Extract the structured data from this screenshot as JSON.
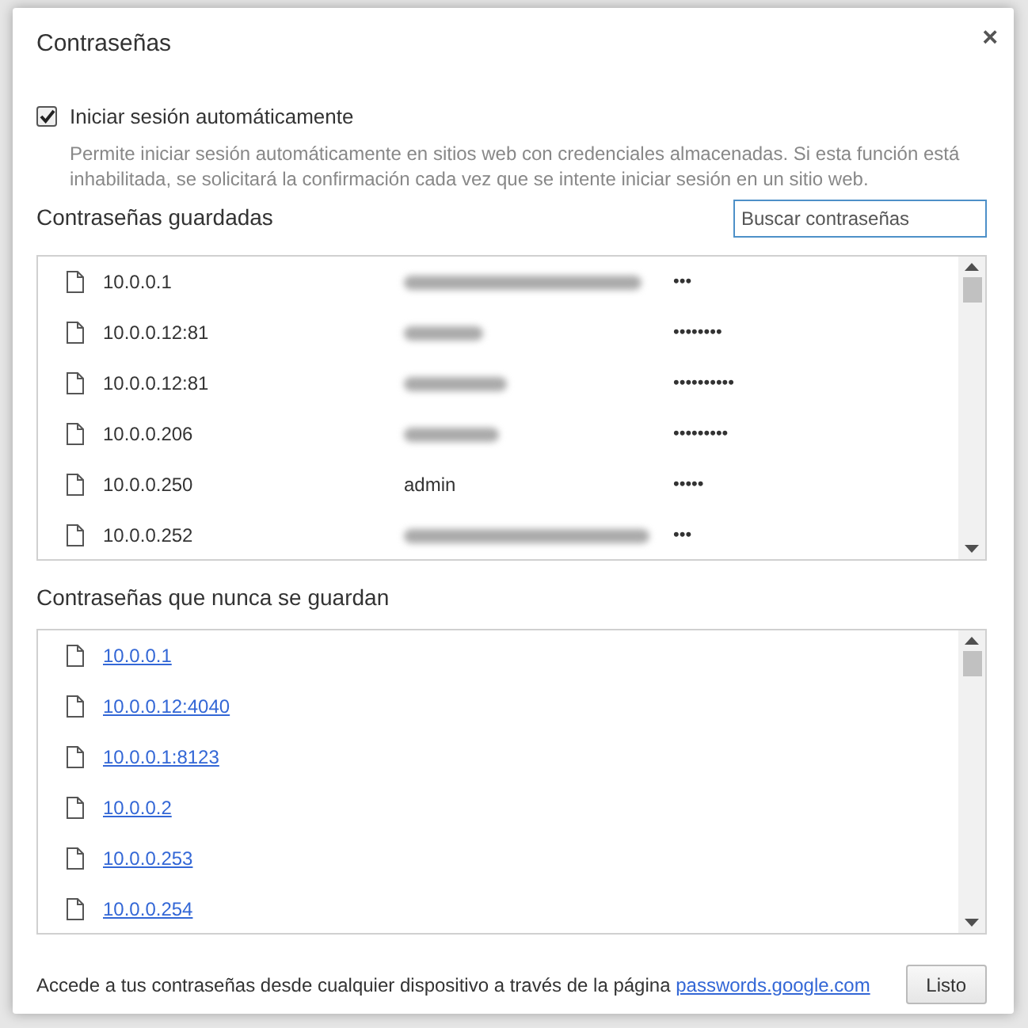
{
  "dialog": {
    "title": "Contraseñas",
    "close": "×"
  },
  "auto_signin": {
    "label": "Iniciar sesión automáticamente",
    "checked": true,
    "description": "Permite iniciar sesión automáticamente en sitios web con credenciales almacenadas. Si esta función está inhabilitada, se solicitará la confirmación cada vez que se intente iniciar sesión en un sitio web."
  },
  "saved": {
    "heading": "Contraseñas guardadas",
    "search": {
      "placeholder": "Buscar contraseñas"
    },
    "rows": [
      {
        "site": "10.0.0.1",
        "kind": "redacted",
        "password": "•••"
      },
      {
        "site": "10.0.0.12:81",
        "kind": "redacted",
        "password": "••••••••"
      },
      {
        "site": "10.0.0.12:81",
        "kind": "redacted",
        "password": "••••••••••"
      },
      {
        "site": "10.0.0.206",
        "kind": "redacted",
        "password": "•••••••••"
      },
      {
        "site": "10.0.0.250",
        "kind": "plain",
        "username": "admin",
        "password": "•••••"
      },
      {
        "site": "10.0.0.252",
        "kind": "redacted",
        "password": "•••"
      }
    ]
  },
  "never_saved": {
    "heading": "Contraseñas que nunca se guardan",
    "rows": [
      "10.0.0.1",
      "10.0.0.12:4040",
      "10.0.0.1:8123",
      "10.0.0.2",
      "10.0.0.253",
      "10.0.0.254"
    ]
  },
  "footer": {
    "text": "Accede a tus contraseñas desde cualquier dispositivo a través de la página",
    "link": "passwords.google.com",
    "button": "Listo"
  }
}
